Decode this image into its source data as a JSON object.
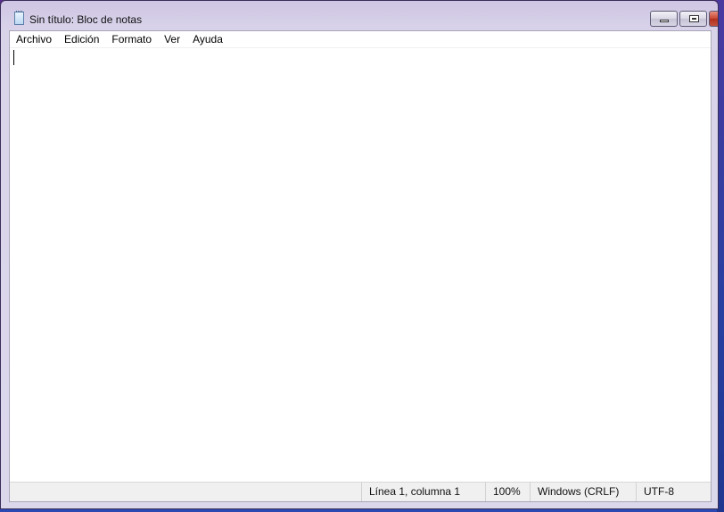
{
  "window": {
    "title": "Sin título: Bloc de notas"
  },
  "menu": {
    "items": [
      "Archivo",
      "Edición",
      "Formato",
      "Ver",
      "Ayuda"
    ]
  },
  "editor": {
    "content": ""
  },
  "status": {
    "position": "Línea 1, columna 1",
    "zoom": "100%",
    "line_ending": "Windows (CRLF)",
    "encoding": "UTF-8"
  },
  "icons": {
    "app": "notepad-icon",
    "minimize": "minimize-icon",
    "maximize": "maximize-icon",
    "close": "close-icon"
  },
  "colors": {
    "desktop": "#3d3fa8",
    "frame": "#d9d3ea",
    "close_button": "#c7452f"
  }
}
